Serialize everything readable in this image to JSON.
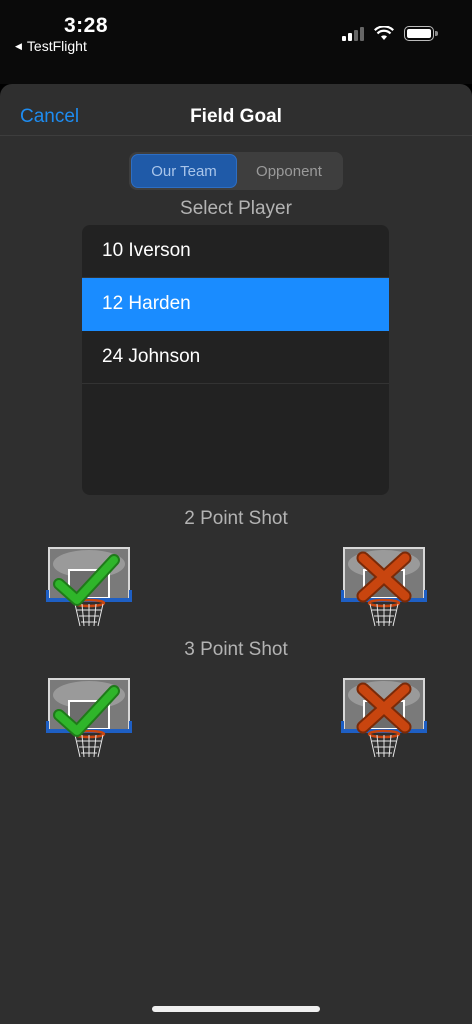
{
  "status": {
    "time": "3:28",
    "back_app": "TestFlight"
  },
  "nav": {
    "cancel_label": "Cancel",
    "title": "Field Goal"
  },
  "segment": {
    "options": [
      "Our Team",
      "Opponent"
    ],
    "selected": "Our Team"
  },
  "select_player_label": "Select Player",
  "players": [
    {
      "label": "10 Iverson",
      "selected": false
    },
    {
      "label": "12 Harden",
      "selected": true
    },
    {
      "label": "24 Johnson",
      "selected": false
    }
  ],
  "two_point_label": "2 Point Shot",
  "three_point_label": "3 Point Shot",
  "colors": {
    "accent": "#1e8cf0",
    "selected_row": "#1a8cff",
    "make_green": "#2fb52a",
    "miss_orange": "#c8450f",
    "rim_blue": "#1e5fc4"
  },
  "icons": {
    "make": "hoop-check-icon",
    "miss": "hoop-x-icon"
  }
}
